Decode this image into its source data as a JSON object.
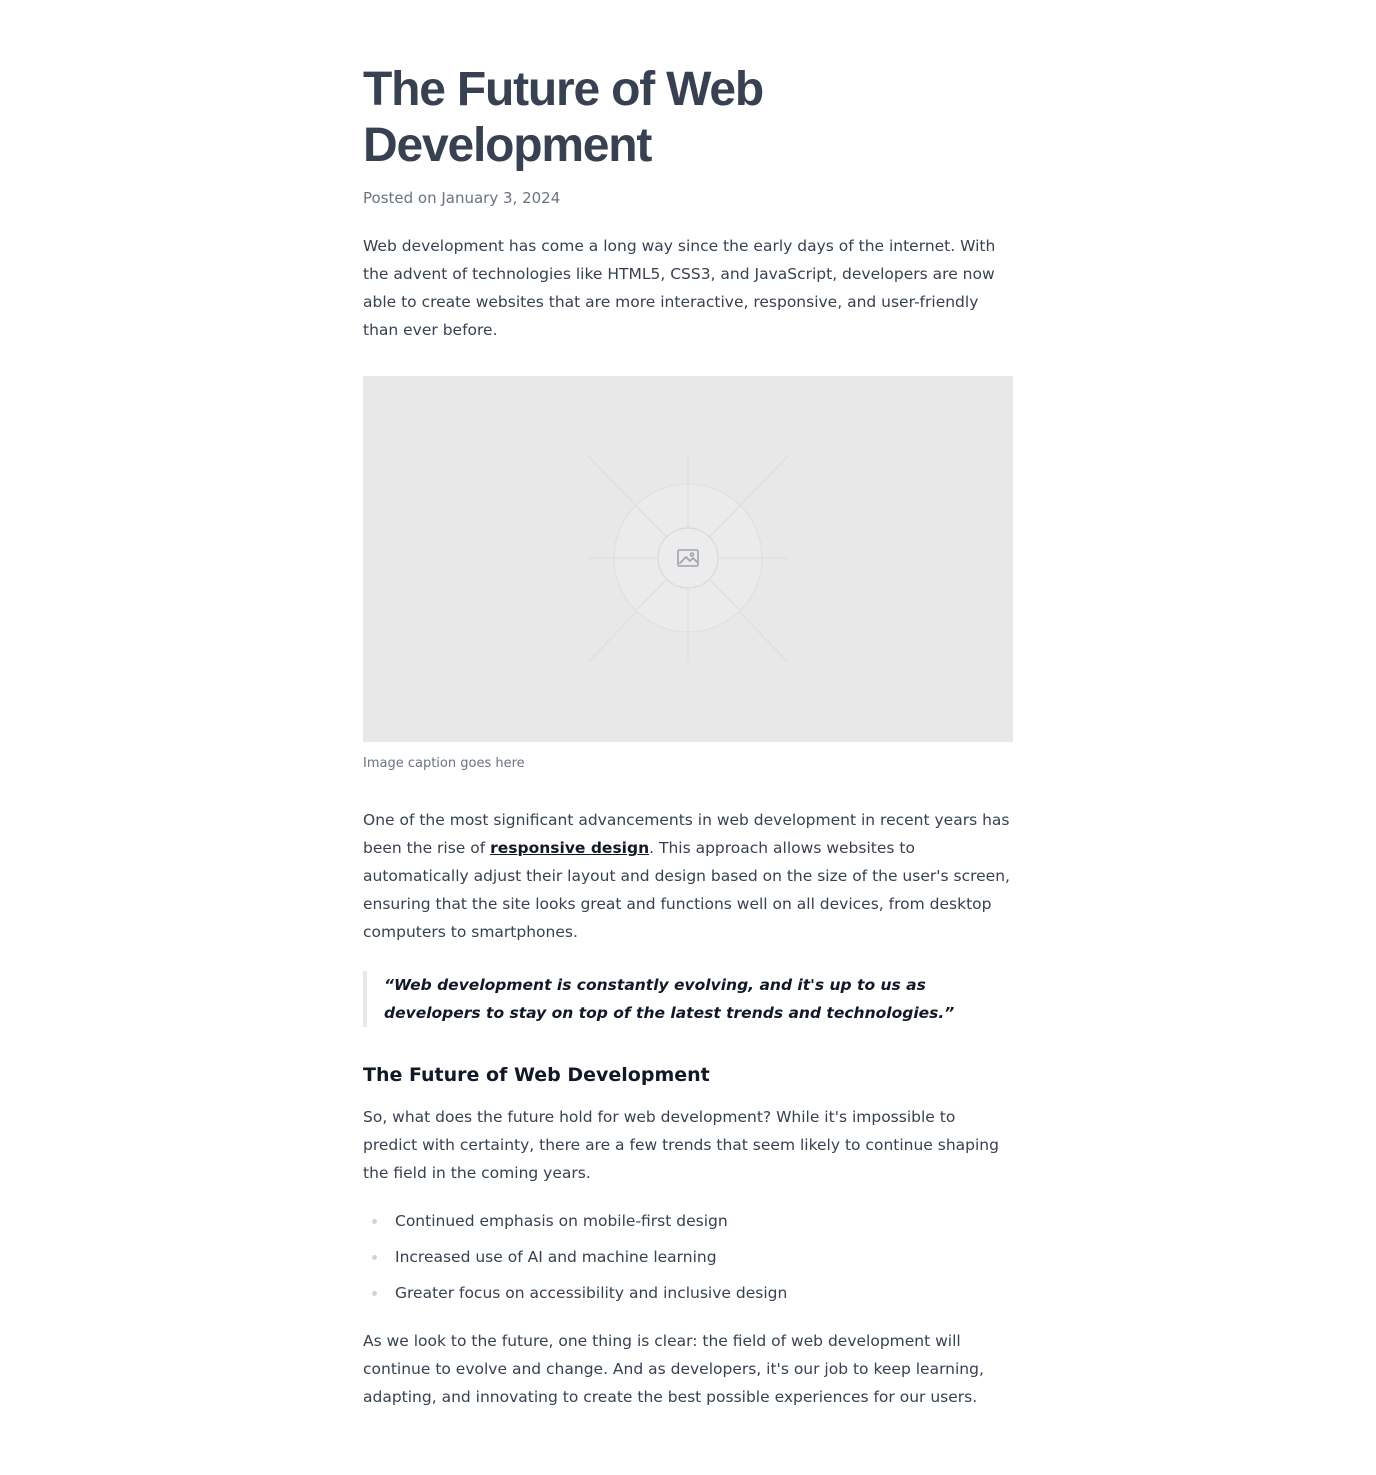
{
  "article": {
    "title": "The Future of Web Development",
    "posted": "Posted on January 3, 2024",
    "intro": "Web development has come a long way since the early days of the internet. With the advent of technologies like HTML5, CSS3, and JavaScript, developers are now able to create websites that are more interactive, responsive, and user-friendly than ever before.",
    "figure": {
      "icon": "image-icon",
      "caption": "Image caption goes here"
    },
    "para2": {
      "before": "One of the most significant advancements in web development in recent years has been the rise of ",
      "link": "responsive design",
      "after": ". This approach allows websites to automatically adjust their layout and design based on the size of the user's screen, ensuring that the site looks great and functions well on all devices, from desktop computers to smartphones."
    },
    "quote": "“Web development is constantly evolving, and it's up to us as developers to stay on top of the latest trends and technologies.”",
    "subheading": "The Future of Web Development",
    "para3": "So, what does the future hold for web development? While it's impossible to predict with certainty, there are a few trends that seem likely to continue shaping the field in the coming years.",
    "list": [
      "Continued emphasis on mobile-first design",
      "Increased use of AI and machine learning",
      "Greater focus on accessibility and inclusive design"
    ],
    "para4": "As we look to the future, one thing is clear: the field of web development will continue to evolve and change. And as developers, it's our job to keep learning, adapting, and innovating to create the best possible experiences for our users."
  }
}
